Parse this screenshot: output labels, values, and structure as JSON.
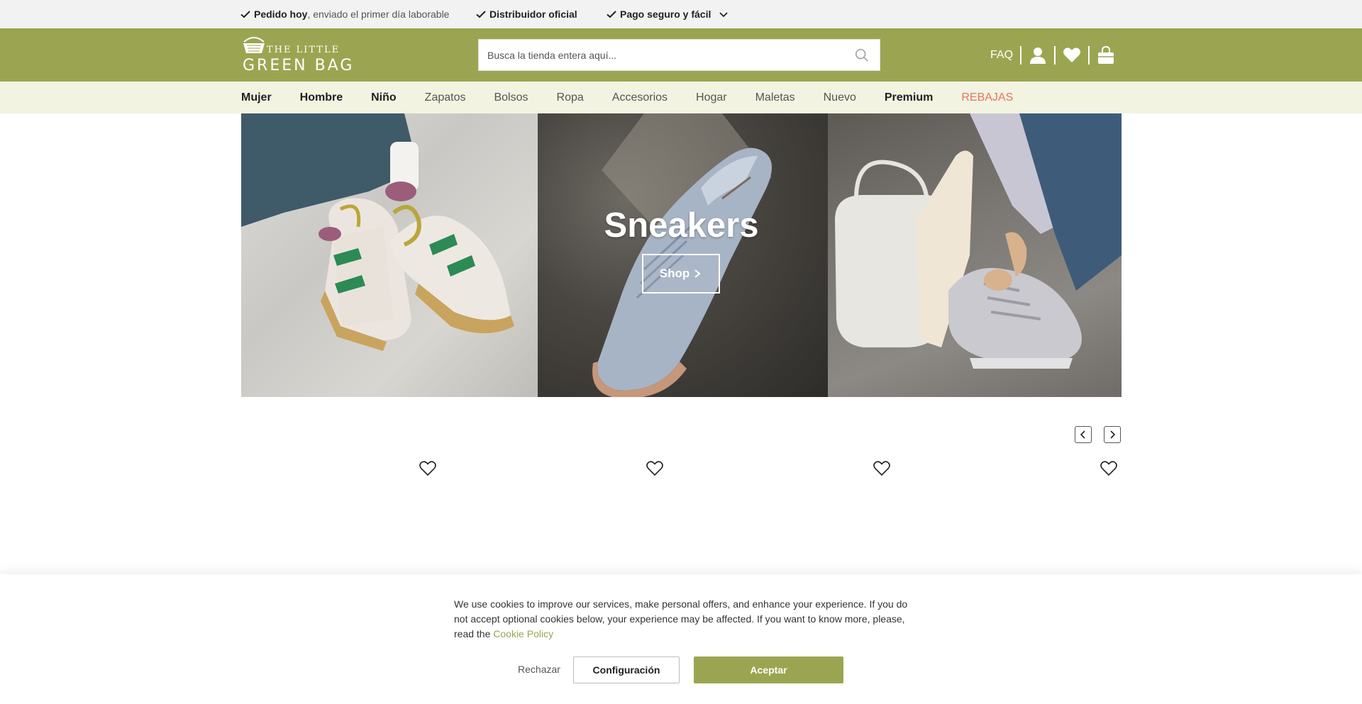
{
  "usp_bar": {
    "item1_bold": "Pedido hoy",
    "item1_rest": ", enviado el primer día laborable",
    "item2": "Distribuidor oficial",
    "item3": "Pago seguro y fácil"
  },
  "header": {
    "logo_line1": "THE LITTLE",
    "logo_line2": "GREEN BAG",
    "search_placeholder": "Busca la tienda entera aquí...",
    "faq_label": "FAQ"
  },
  "nav": {
    "items": [
      "Mujer",
      "Hombre",
      "Niño",
      "Zapatos",
      "Bolsos",
      "Ropa",
      "Accesorios",
      "Hogar",
      "Maletas",
      "Nuevo",
      "Premium",
      "REBAJAS"
    ]
  },
  "hero": {
    "title": "Sneakers",
    "button_label": "Shop"
  },
  "cookie": {
    "text": "We use cookies to improve our services, make personal offers, and enhance your experience. If you do not accept optional cookies below, your experience may be affected. If you want to know more, please, read the ",
    "policy_link": "Cookie Policy",
    "reject_label": "Rechazar",
    "config_label": "Configuración",
    "accept_label": "Aceptar"
  },
  "colors": {
    "brand_green": "#9ba551",
    "nav_bg": "#f2f3e1",
    "sale_red": "#e8745c",
    "usp_bg": "#f2f2f2"
  },
  "icons": [
    "check-icon",
    "chevron-down-icon",
    "search-icon",
    "user-icon",
    "heart-icon",
    "shopping-bag-icon",
    "chevron-right-icon",
    "chevron-left-icon"
  ]
}
